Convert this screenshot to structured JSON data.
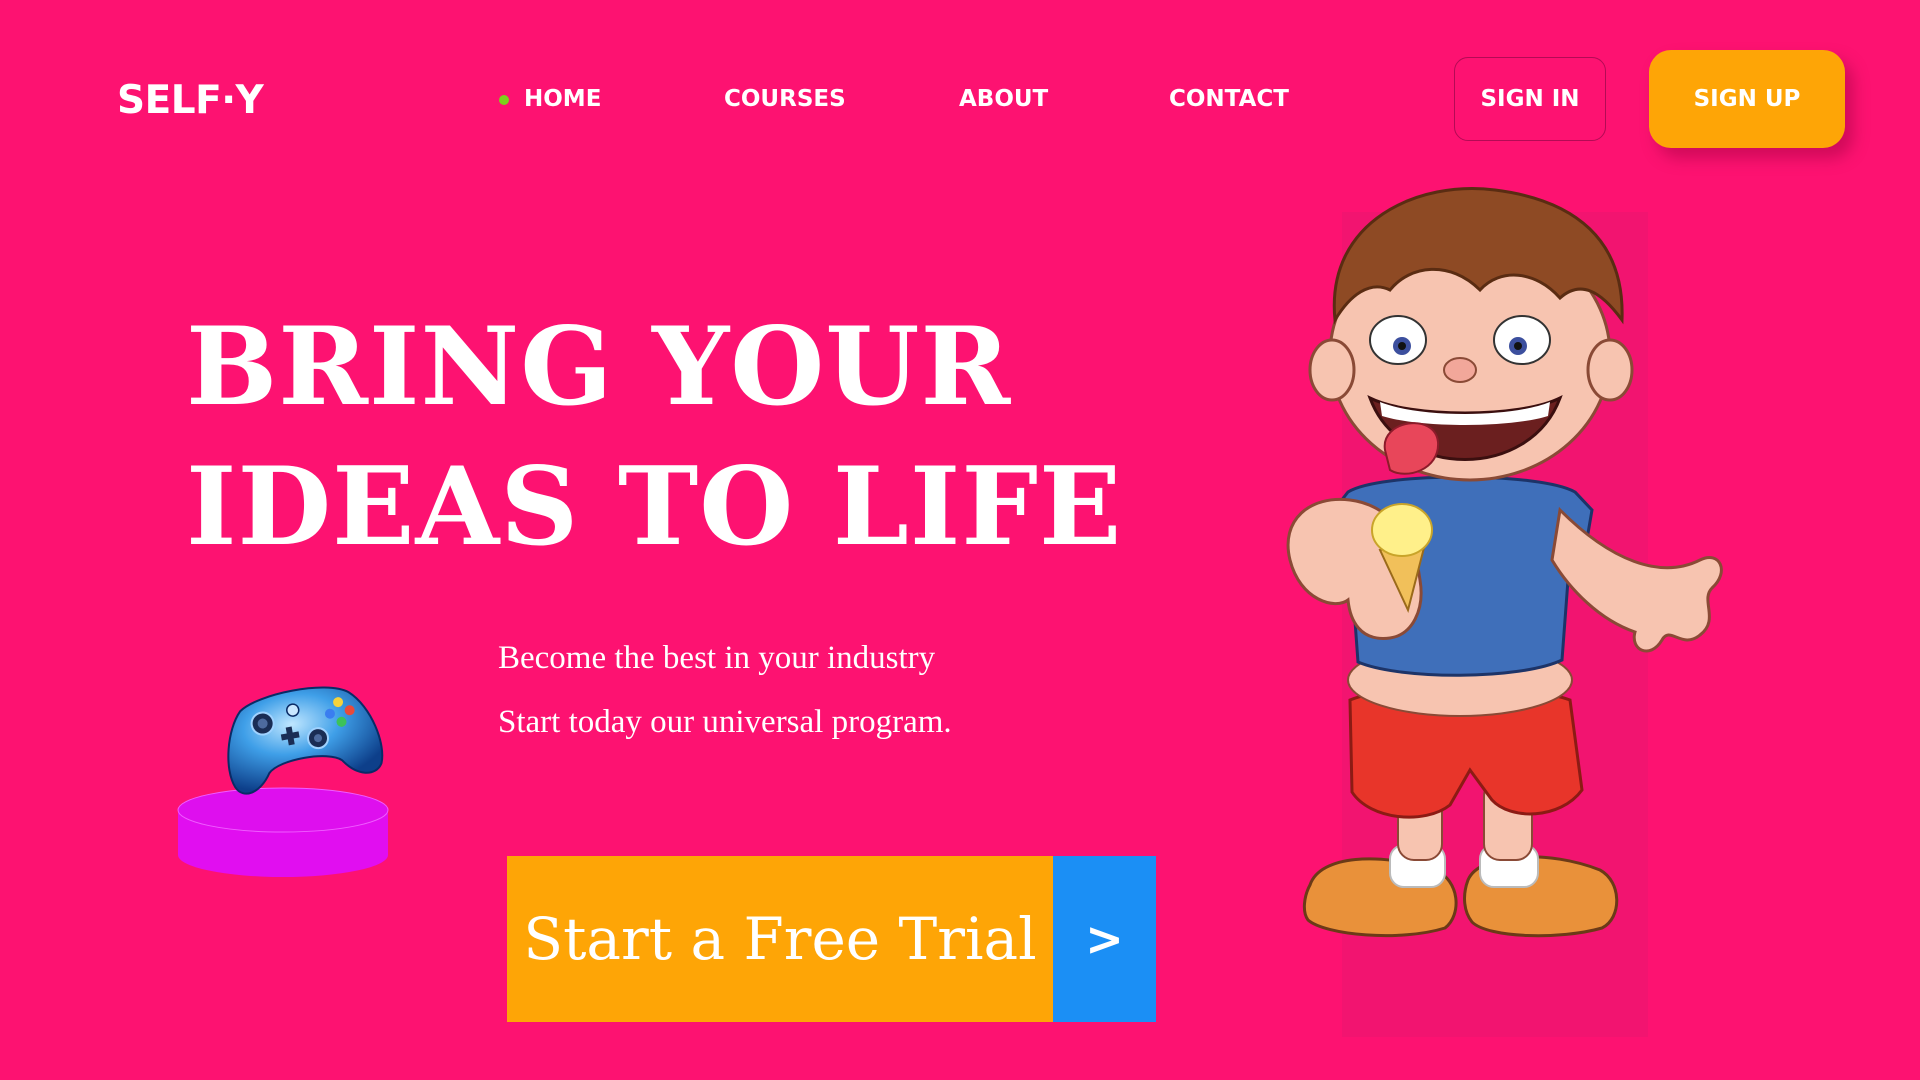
{
  "brand": {
    "logo": "SELF·Y"
  },
  "nav": {
    "items": [
      {
        "label": "HOME",
        "active": true
      },
      {
        "label": "COURSES"
      },
      {
        "label": "ABOUT"
      },
      {
        "label": "CONTACT"
      }
    ]
  },
  "auth": {
    "sign_in": "SIGN IN",
    "sign_up": "SIGN UP"
  },
  "hero": {
    "headline_line1": "BRING YOUR",
    "headline_line2": "IDEAS TO LIFE",
    "subtitle_line1": "Become the best in your industry",
    "subtitle_line2": "Start today our universal program."
  },
  "cta": {
    "label": "Start a Free Trial",
    "arrow": ">"
  },
  "images": {
    "gamepad": "gamepad-icon",
    "boy": "boy-eating-ice-cream-illustration"
  },
  "colors": {
    "background": "#fd1271",
    "accent_orange": "#fea506",
    "accent_blue": "#1b8ff5",
    "active_dot": "#7cd11b",
    "pedestal": "#e10ef0"
  }
}
